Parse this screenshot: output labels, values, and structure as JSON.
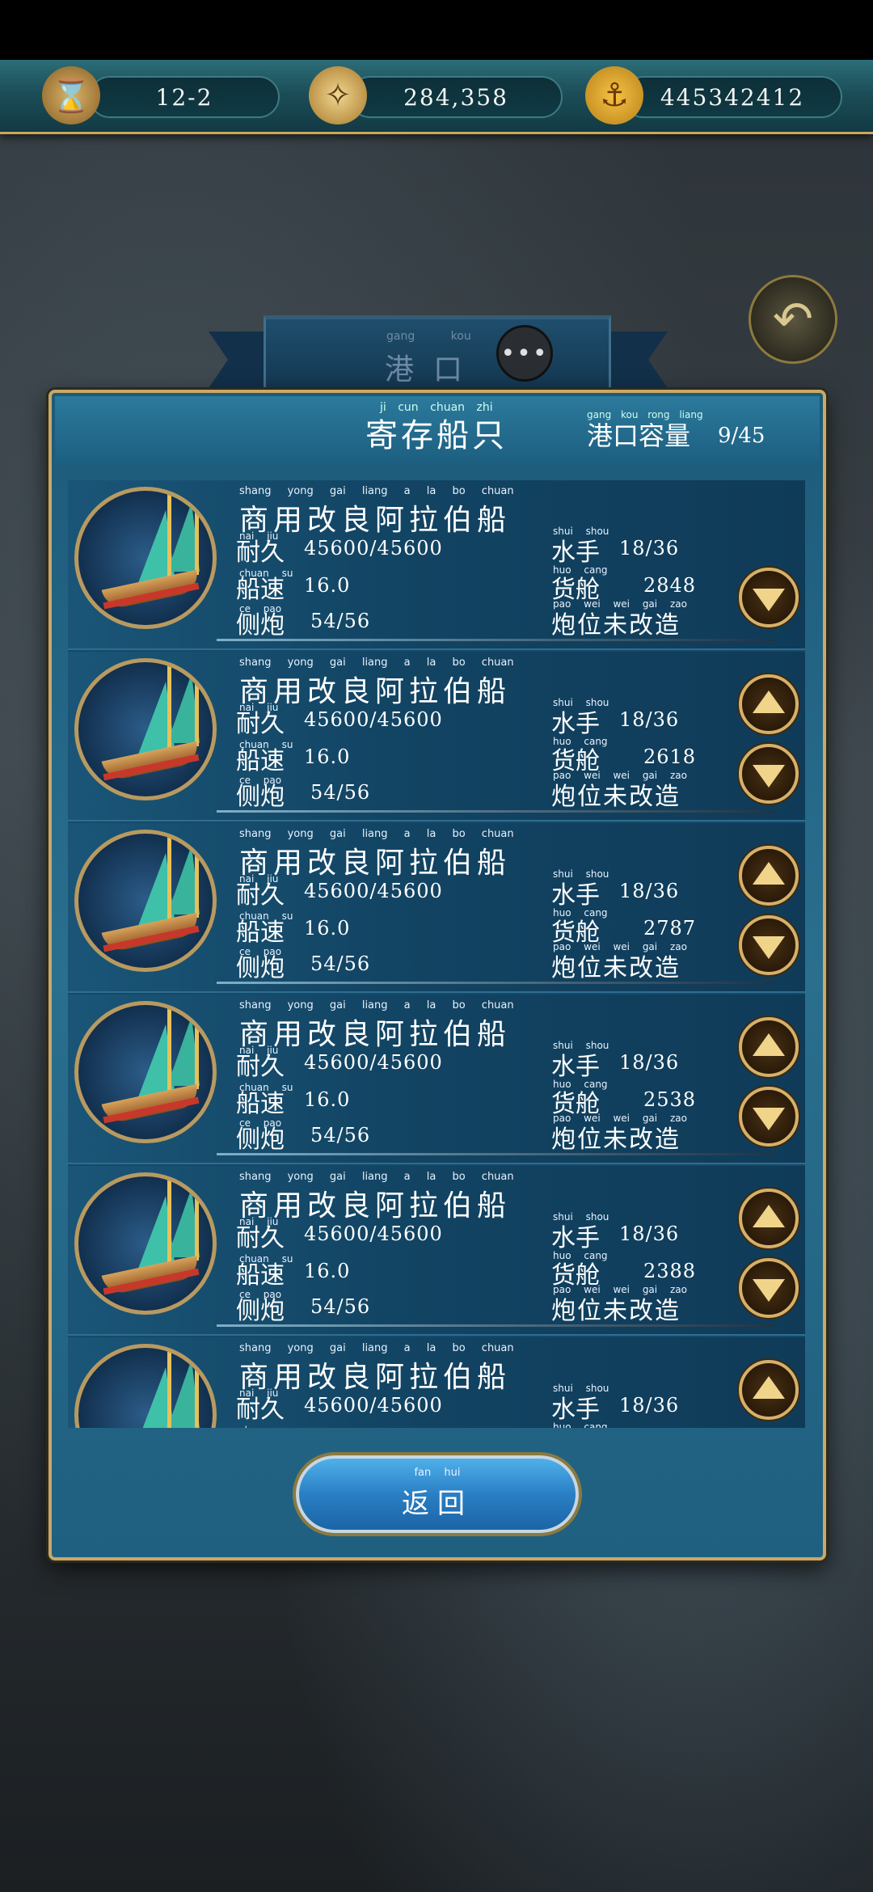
{
  "topbar": {
    "stage": "12-2",
    "compass_value": "284,358",
    "gold_value": "445342412"
  },
  "port": {
    "title": "港口",
    "title_pinyin": "gang kou"
  },
  "panel": {
    "title": "寄存船只",
    "title_pinyin": "ji cun chuan zhi",
    "capacity_label": "港口容量",
    "capacity_pinyin": "gang kou rong liang",
    "capacity_value": "9/45"
  },
  "labels": {
    "durability": "耐久",
    "durability_py": "nai jiu",
    "speed": "船速",
    "speed_py": "chuan su",
    "cannon": "侧炮",
    "cannon_py": "ce pao",
    "crew": "水手",
    "crew_py": "shui shou",
    "cargo": "货舱",
    "cargo_py": "huo cang",
    "slot": "炮位未改造",
    "slot_py": "pao wei wei gai zao",
    "name_py": "shang yong gai liang a la bo chuan"
  },
  "ships": [
    {
      "name": "商用改良阿拉伯船",
      "durability": "45600/45600",
      "speed": "16.0",
      "cannon": "54/56",
      "crew": "18/36",
      "cargo": "2848"
    },
    {
      "name": "商用改良阿拉伯船",
      "durability": "45600/45600",
      "speed": "16.0",
      "cannon": "54/56",
      "crew": "18/36",
      "cargo": "2618"
    },
    {
      "name": "商用改良阿拉伯船",
      "durability": "45600/45600",
      "speed": "16.0",
      "cannon": "54/56",
      "crew": "18/36",
      "cargo": "2787"
    },
    {
      "name": "商用改良阿拉伯船",
      "durability": "45600/45600",
      "speed": "16.0",
      "cannon": "54/56",
      "crew": "18/36",
      "cargo": "2538"
    },
    {
      "name": "商用改良阿拉伯船",
      "durability": "45600/45600",
      "speed": "16.0",
      "cannon": "54/56",
      "crew": "18/36",
      "cargo": "2388"
    },
    {
      "name": "商用改良阿拉伯船",
      "durability": "45600/45600",
      "speed": "",
      "cannon": "",
      "crew": "18/36",
      "cargo": ""
    }
  ],
  "return_button": {
    "label": "返回",
    "pinyin": "fan hui"
  },
  "icons": {
    "hourglass": "hourglass-icon",
    "compass": "compass-icon",
    "anchor": "anchor-coin-icon",
    "back": "back-arrow-icon",
    "chat": "chat-bubble-icon"
  }
}
